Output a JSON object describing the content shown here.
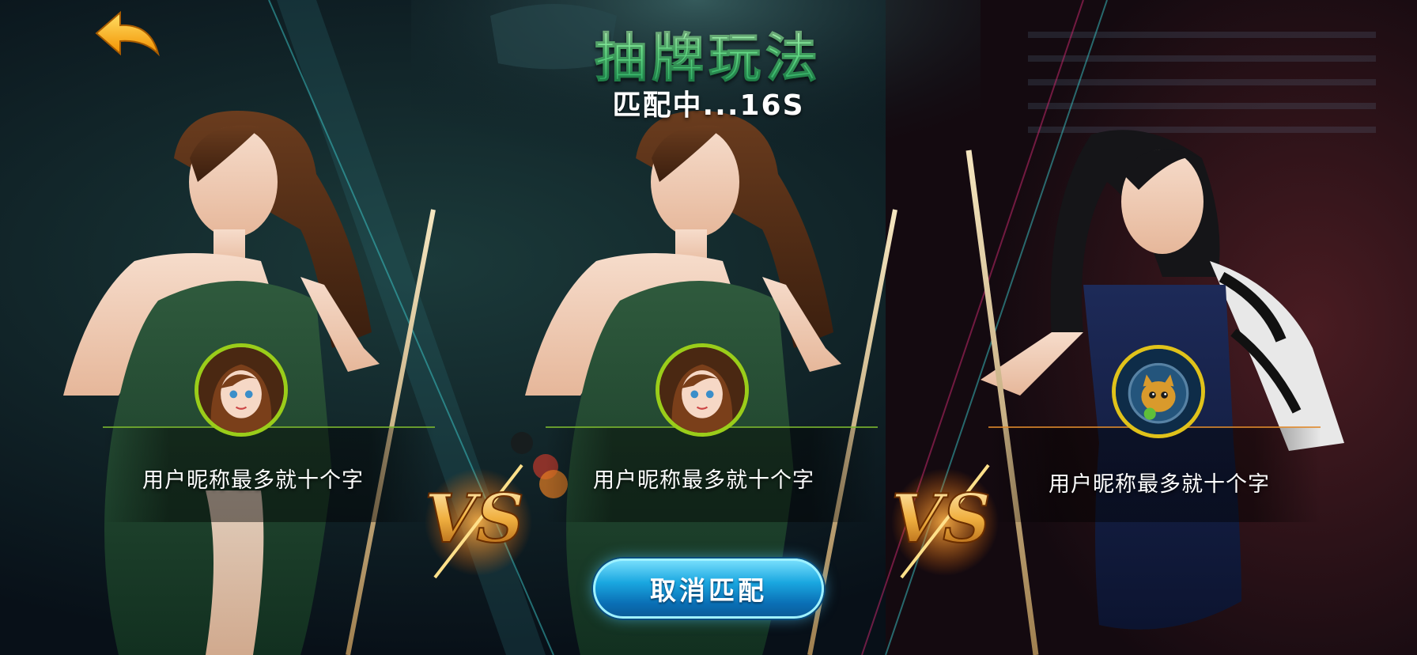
{
  "header": {
    "title": "抽牌玩法",
    "status": "匹配中...16S"
  },
  "players": [
    {
      "name": "用户昵称最多就十个字",
      "avatar": "girl-avatar",
      "ring_color": "#9acd1a"
    },
    {
      "name": "用户昵称最多就十个字",
      "avatar": "girl-avatar",
      "ring_color": "#9acd1a"
    },
    {
      "name": "用户昵称最多就十个字",
      "avatar": "astronaut-cat-avatar",
      "ring_color": "#e0c21a"
    }
  ],
  "vs_label": "VS",
  "cancel_button": {
    "label": "取消匹配"
  },
  "icons": {
    "back": "back-arrow-icon"
  },
  "colors": {
    "title_green": "#34c77a",
    "button_blue": "#1aa7e0",
    "back_arrow_gold": "#ffb400"
  }
}
